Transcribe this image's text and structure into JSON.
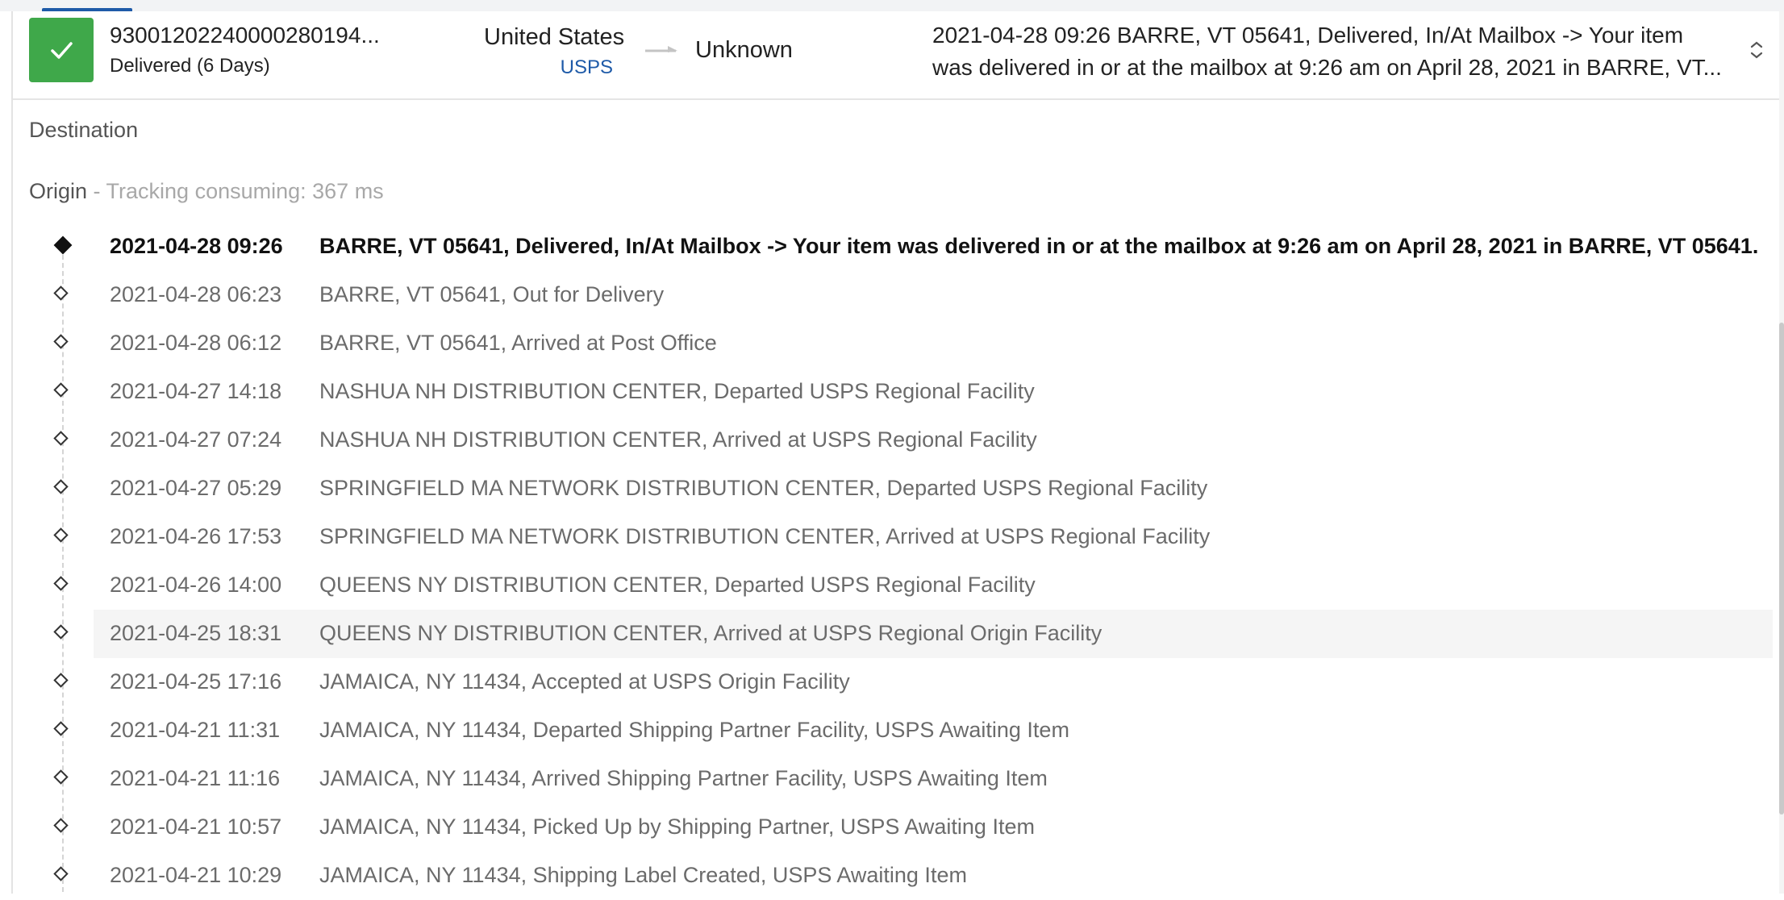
{
  "shipment": {
    "tracking_number": "9300120224000028019­4...",
    "status": "Delivered (6 Days)",
    "status_color": "#3fa84a",
    "origin_country": "United States",
    "carrier": "USPS",
    "destination_country": "Unknown",
    "latest_event_line1": "2021-04-28 09:26  BARRE, VT 05641, Delivered, In/At Mailbox -> Your item",
    "latest_event_line2": "was delivered in or at the mailbox at 9:26 am on April 28, 2021 in BARRE, VT..."
  },
  "details": {
    "destination_label": "Destination",
    "origin_label": "Origin",
    "tracking_consuming": " - Tracking consuming: 367 ms"
  },
  "events": [
    {
      "time": "2021-04-28 09:26",
      "description": "BARRE, VT 05641, Delivered, In/At Mailbox -> Your item was delivered in or at the mailbox at 9:26 am on April 28, 2021 in BARRE, VT 05641."
    },
    {
      "time": "2021-04-28 06:23",
      "description": "BARRE, VT 05641, Out for Delivery"
    },
    {
      "time": "2021-04-28 06:12",
      "description": "BARRE, VT 05641, Arrived at Post Office"
    },
    {
      "time": "2021-04-27 14:18",
      "description": "NASHUA NH DISTRIBUTION CENTER, Departed USPS Regional Facility"
    },
    {
      "time": "2021-04-27 07:24",
      "description": "NASHUA NH DISTRIBUTION CENTER, Arrived at USPS Regional Facility"
    },
    {
      "time": "2021-04-27 05:29",
      "description": "SPRINGFIELD MA NETWORK DISTRIBUTION CENTER, Departed USPS Regional Facility"
    },
    {
      "time": "2021-04-26 17:53",
      "description": "SPRINGFIELD MA NETWORK DISTRIBUTION CENTER, Arrived at USPS Regional Facility"
    },
    {
      "time": "2021-04-26 14:00",
      "description": "QUEENS NY DISTRIBUTION CENTER, Departed USPS Regional Facility"
    },
    {
      "time": "2021-04-25 18:31",
      "description": "QUEENS NY DISTRIBUTION CENTER, Arrived at USPS Regional Origin Facility"
    },
    {
      "time": "2021-04-25 17:16",
      "description": "JAMAICA, NY 11434, Accepted at USPS Origin Facility"
    },
    {
      "time": "2021-04-21 11:31",
      "description": "JAMAICA, NY 11434, Departed Shipping Partner Facility, USPS Awaiting Item"
    },
    {
      "time": "2021-04-21 11:16",
      "description": "JAMAICA, NY 11434, Arrived Shipping Partner Facility, USPS Awaiting Item"
    },
    {
      "time": "2021-04-21 10:57",
      "description": "JAMAICA, NY 11434, Picked Up by Shipping Partner, USPS Awaiting Item"
    },
    {
      "time": "2021-04-21 10:29",
      "description": "JAMAICA, NY 11434, Shipping Label Created, USPS Awaiting Item"
    }
  ],
  "icons": {
    "status": "checkmark-icon",
    "route": "arrow-right-icon",
    "collapse": "chevron-up-icon",
    "latest_marker": "filled-diamond-icon",
    "event_marker": "diamond-icon"
  }
}
